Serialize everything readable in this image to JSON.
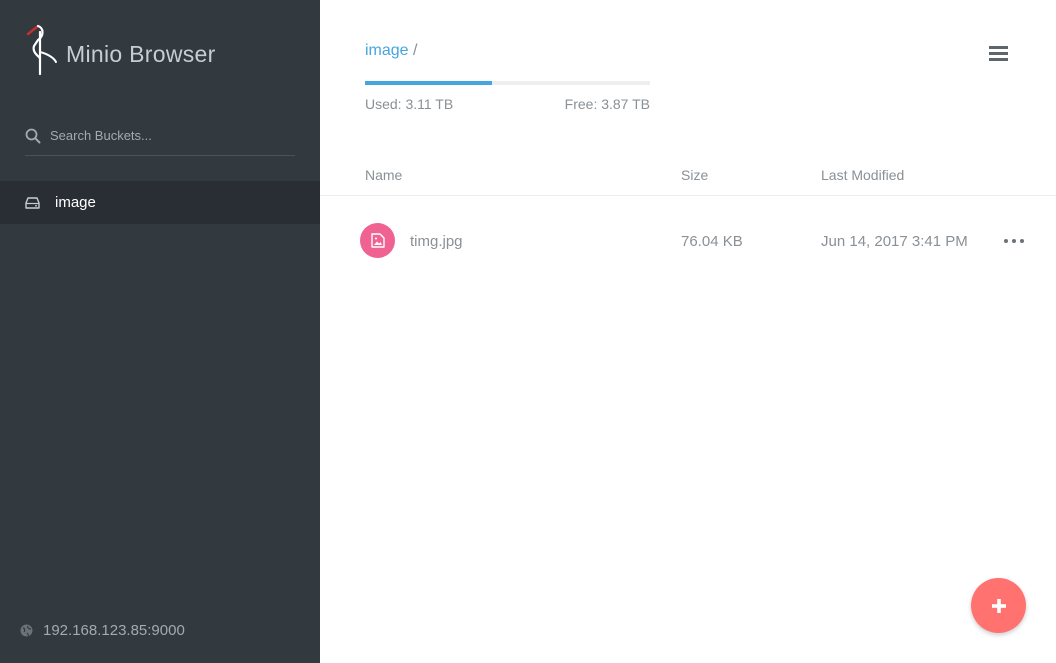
{
  "app": {
    "title": "Minio Browser"
  },
  "sidebar": {
    "search": {
      "placeholder": "Search Buckets..."
    },
    "buckets": [
      {
        "label": "image",
        "icon": "hard-drive-icon",
        "active": true
      }
    ],
    "host": {
      "address": "192.168.123.85:9000",
      "icon": "globe-icon"
    }
  },
  "header": {
    "breadcrumb": {
      "bucket": "image",
      "separator": "/"
    },
    "menu_icon": "hamburger-icon"
  },
  "storage": {
    "used_label": "Used: 3.11 TB",
    "free_label": "Free: 3.87 TB",
    "used_fraction": 0.445
  },
  "table": {
    "columns": {
      "name": "Name",
      "size": "Size",
      "modified": "Last Modified"
    },
    "rows": [
      {
        "name": "timg.jpg",
        "size": "76.04 KB",
        "modified": "Jun 14, 2017 3:41 PM",
        "icon": "image-file-icon"
      }
    ]
  },
  "fab": {
    "icon": "plus-icon"
  },
  "colors": {
    "sidebar_bg": "#32393f",
    "accent_blue": "#46a5e0",
    "file_icon_pink": "#f06292",
    "fab_red": "#ff726f"
  }
}
